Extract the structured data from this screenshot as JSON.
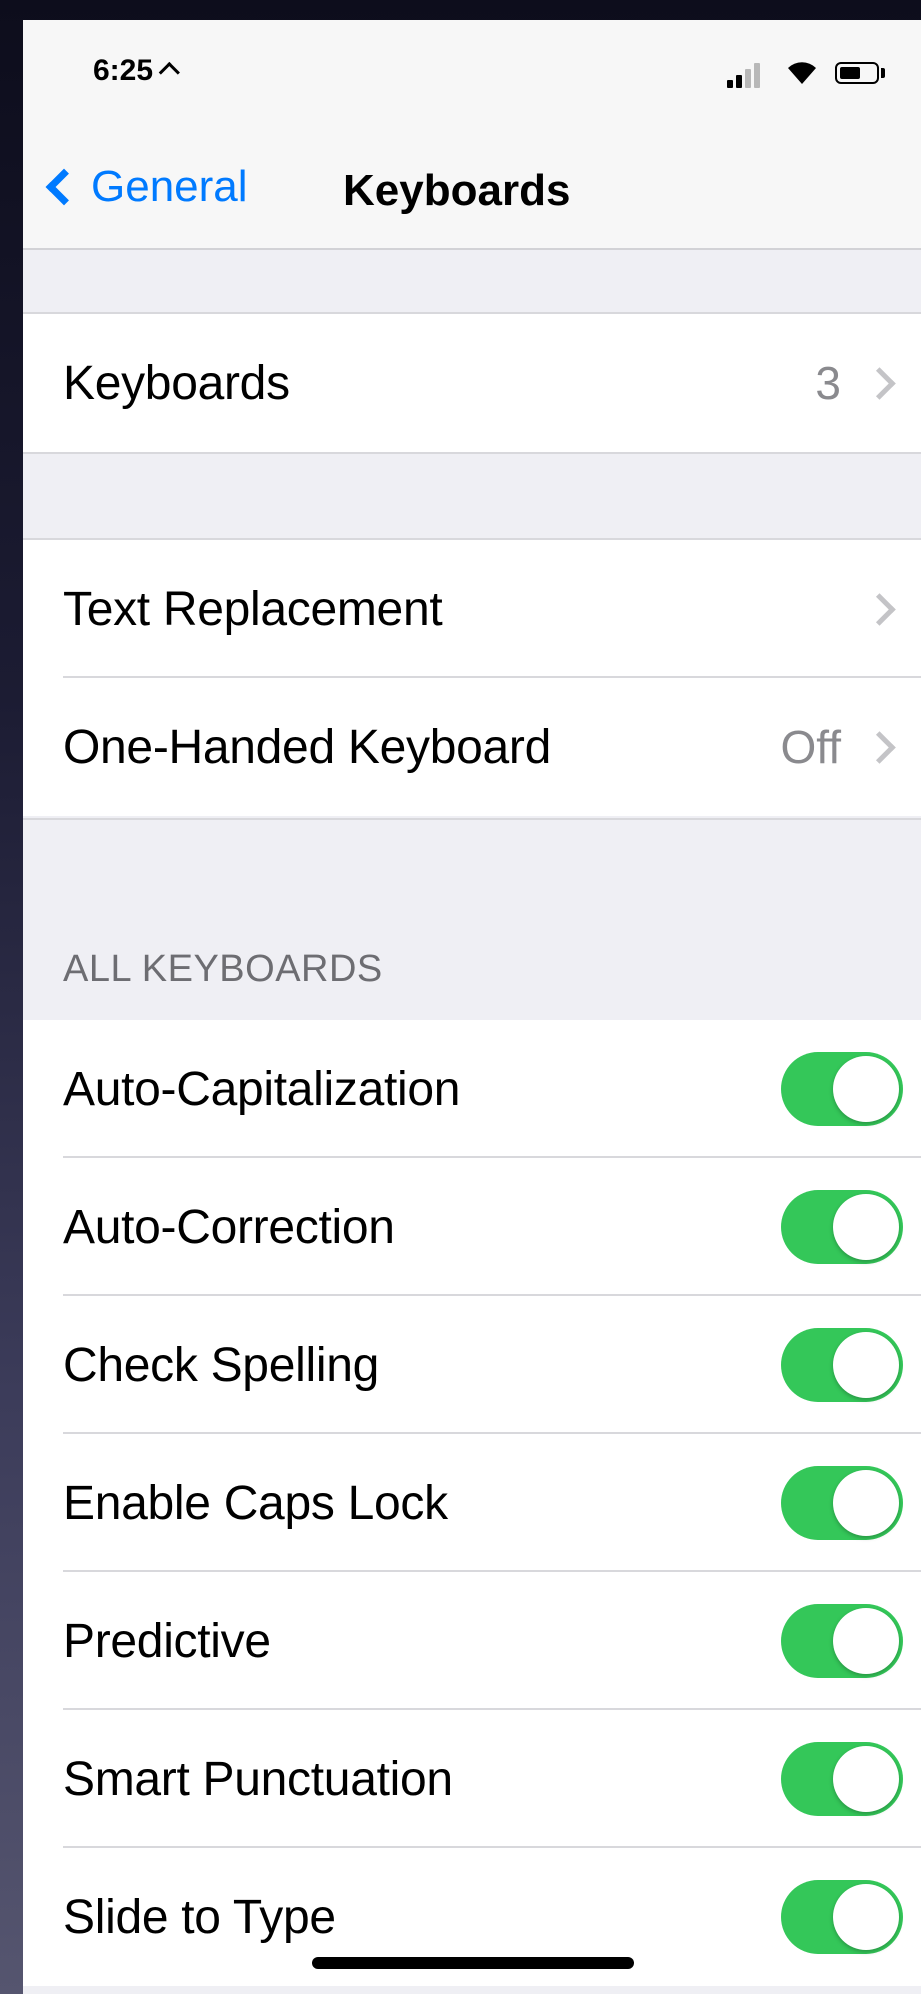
{
  "status_bar": {
    "time": "6:25"
  },
  "nav": {
    "back_label": "General",
    "title": "Keyboards"
  },
  "keyboards_row": {
    "label": "Keyboards",
    "value": "3"
  },
  "text_options": [
    {
      "label": "Text Replacement",
      "value": ""
    },
    {
      "label": "One-Handed Keyboard",
      "value": "Off"
    }
  ],
  "all_keyboards": {
    "header": "ALL KEYBOARDS",
    "toggles": [
      {
        "label": "Auto-Capitalization",
        "on": true
      },
      {
        "label": "Auto-Correction",
        "on": true
      },
      {
        "label": "Check Spelling",
        "on": true
      },
      {
        "label": "Enable Caps Lock",
        "on": true
      },
      {
        "label": "Predictive",
        "on": true
      },
      {
        "label": "Smart Punctuation",
        "on": true
      },
      {
        "label": "Slide to Type",
        "on": true
      }
    ]
  },
  "colors": {
    "accent": "#007aff",
    "toggle_on": "#34c759",
    "background": "#efeff4"
  }
}
